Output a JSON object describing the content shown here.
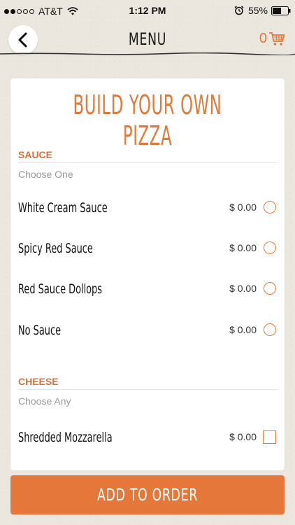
{
  "status": {
    "carrier": "AT&T",
    "time": "1:12 PM",
    "battery": "55%"
  },
  "nav": {
    "title": "MENU",
    "cart_count": "0"
  },
  "card": {
    "title": "BUILD YOUR OWN PIZZA",
    "sections": [
      {
        "title": "SAUCE",
        "subtitle": "Choose One",
        "control": "radio",
        "options": [
          {
            "name": "White Cream Sauce",
            "price": "$ 0.00"
          },
          {
            "name": "Spicy Red Sauce",
            "price": "$ 0.00"
          },
          {
            "name": "Red Sauce Dollops",
            "price": "$ 0.00"
          },
          {
            "name": "No Sauce",
            "price": "$ 0.00"
          }
        ]
      },
      {
        "title": "CHEESE",
        "subtitle": "Choose Any",
        "control": "checkbox",
        "options": [
          {
            "name": "Shredded Mozzarella",
            "price": "$ 0.00"
          }
        ]
      }
    ]
  },
  "actions": {
    "add_label": "ADD TO ORDER"
  },
  "colors": {
    "accent": "#e07a3a",
    "background": "#ece7de",
    "card": "#ffffff"
  },
  "icons": {
    "back": "back-arrow-icon",
    "cart": "cart-icon",
    "wifi": "wifi-icon",
    "alarm": "alarm-icon",
    "battery": "battery-icon"
  }
}
